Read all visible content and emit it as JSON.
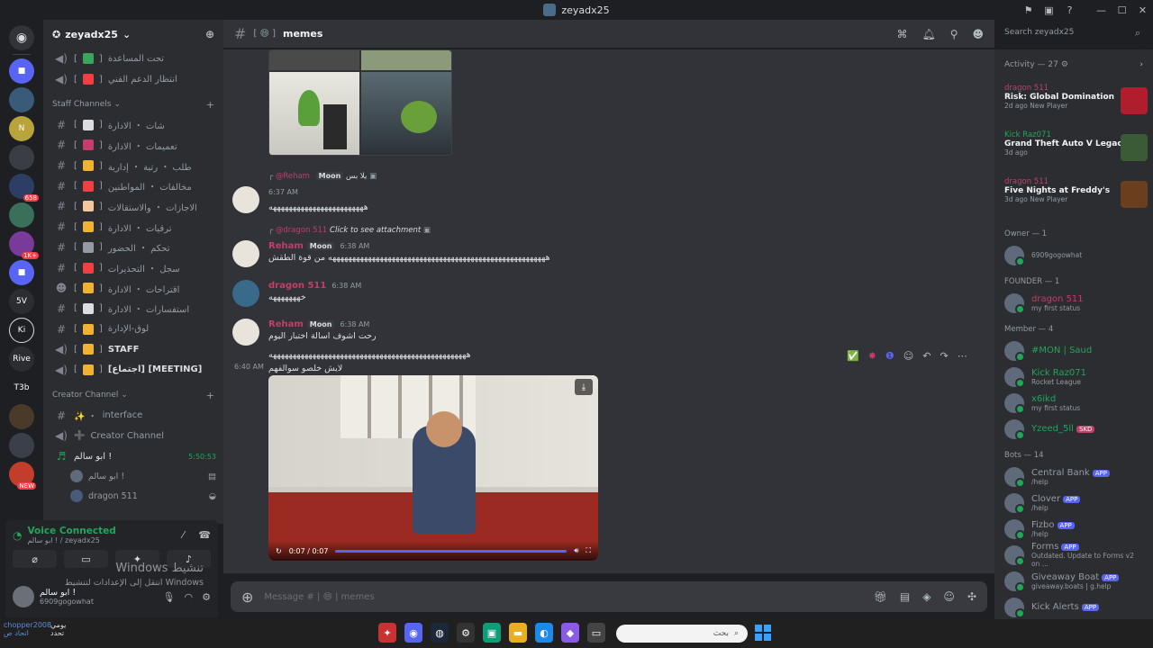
{
  "window": {
    "title": "zeyadx25"
  },
  "server": {
    "name": "zeyadx25"
  },
  "guild_badges": [
    "658",
    "1K+",
    "NEW"
  ],
  "guild_labels": [
    "5V",
    "Ki",
    "Rive",
    "T3b"
  ],
  "channels_top": [
    {
      "icon": "speaker",
      "label": "تحت المساعدة",
      "emoji_color": "#3ba55c"
    },
    {
      "icon": "speaker",
      "label": "انتظار الدعم الفني",
      "emoji_color": "#f23f43"
    }
  ],
  "staff_category": "Staff Channels",
  "staff_channels": [
    {
      "icon": "hash",
      "label": "شات ・ الادارة",
      "emoji_color": "#dbdee1"
    },
    {
      "icon": "hash",
      "label": "تعميمات ・ الادارة",
      "emoji_color": "#c33e68"
    },
    {
      "icon": "hash",
      "label": "طلب ・ رتبة ・ إدارية",
      "emoji_color": "#f0b232"
    },
    {
      "icon": "hash",
      "label": "مخالفات ・ المواطنين",
      "emoji_color": "#f23f43"
    },
    {
      "icon": "hash",
      "label": "الاجازات ・ والاستقالات",
      "emoji_color": "#f2c7a0"
    },
    {
      "icon": "hash",
      "label": "ترقيات ・ الادارة",
      "emoji_color": "#f0b232"
    },
    {
      "icon": "hash",
      "label": "تحكم ・ الحضور",
      "emoji_color": "#949ba4"
    },
    {
      "icon": "hash",
      "label": "سجل ・ التحذيرات",
      "emoji_color": "#f23f43"
    },
    {
      "icon": "people",
      "label": "اقتراحات ・ الادارة",
      "emoji_color": "#f0b232"
    },
    {
      "icon": "hash",
      "label": "استفسارات ・ الادارة",
      "emoji_color": "#dbdee1"
    },
    {
      "icon": "hash",
      "label": "لوق-الإدارة",
      "emoji_color": "#f0b232"
    },
    {
      "icon": "speaker",
      "label": "STAFF",
      "emoji_color": "#f0b232"
    },
    {
      "icon": "speaker",
      "label": "[اجتماع] [MEETING]",
      "emoji_color": "#f0b232"
    }
  ],
  "creator_category": "Creator Channel",
  "creator_channels": [
    {
      "icon": "hash",
      "label": "interface",
      "prefix": "✨ ・ "
    },
    {
      "icon": "speaker",
      "label": "Creator Channel",
      "prefix": "➕ "
    }
  ],
  "voice_channel": {
    "name": "ابو سالم !",
    "timer": "5:50:53"
  },
  "voice_users": [
    "ابو سالم !",
    "dragon 511"
  ],
  "voice_status": {
    "title": "Voice Connected",
    "sub": "ابو سالم ! / zeyadx25"
  },
  "user": {
    "name": "ابو سالم !",
    "status": "6909gogowhat"
  },
  "watermark": {
    "line1": "Windows تنشيط",
    "line2": "انتقل إلى الإعدادات لتنشيط Windows"
  },
  "chat": {
    "channel_name": "memes",
    "composer_placeholder": "Message # | 😄 | memes"
  },
  "search": {
    "placeholder": "Search zeyadx25"
  },
  "messages": [
    {
      "reply_name": "@Reham",
      "reply_tag": "Moon",
      "reply_text": "يلا بس",
      "author": "",
      "time": "6:37 AM",
      "text": "ههههههههههههههههههههههههه",
      "author_color": "#c33e68"
    },
    {
      "reply_name": "@dragon 511",
      "reply_text": "Click to see attachment",
      "author": "Reham",
      "tag": "Moon",
      "time": "6:38 AM",
      "text": "هههههههههههههههههههههههههههههههههههههههههههههههههههههههه من قوة الطقش",
      "author_color": "#c33e68"
    },
    {
      "author": "dragon 511",
      "time": "6:38 AM",
      "text": "خهههههههه",
      "author_color": "#c33e68"
    },
    {
      "author": "Reham",
      "tag": "Moon",
      "time": "6:38 AM",
      "text": "رحت اشوف اسالة اختبار اليوم",
      "text2": "ههههههههههههههههههههههههههههههههههههههههههههههههههه",
      "author_color": "#c33e68"
    }
  ],
  "video_msg": {
    "time": "6:40 AM",
    "text": "لايش خلصو سوالفهم",
    "video_time": "0:07 / 0:07",
    "progress": 1.0
  },
  "activity": {
    "header": "Activity — 27",
    "items": [
      {
        "user": "dragon 511",
        "game": "Risk: Global Domination",
        "meta": "2d ago",
        "extra": "New Player",
        "thumb_color": "#b01e2d"
      },
      {
        "user": "Kick Raz071",
        "game": "Grand Theft Auto V Legacy",
        "meta": "3d ago",
        "extra": "",
        "thumb_color": "#3b5a36",
        "user_color": "#23a55a"
      },
      {
        "user": "dragon 511",
        "game": "Five Nights at Freddy's",
        "meta": "3d ago",
        "extra": "New Player",
        "thumb_color": "#6b3f1e"
      }
    ]
  },
  "member_groups": [
    {
      "title": "Owner — 1",
      "members": [
        {
          "name": "",
          "sub": "6909gogowhat",
          "color": "#c33e68"
        }
      ]
    },
    {
      "title": "FOUNDER — 1",
      "members": [
        {
          "name": "dragon 511",
          "sub": "my first status",
          "color": "#c33e68"
        }
      ]
    },
    {
      "title": "Member — 4",
      "members": [
        {
          "name": "#MON | Saud",
          "sub": "",
          "color": "#23a55a"
        },
        {
          "name": "Kick Raz071",
          "sub": "Rocket League",
          "color": "#23a55a"
        },
        {
          "name": "x6ikd",
          "sub": "my first status",
          "color": "#23a55a"
        },
        {
          "name": "Yzeed_5ll",
          "sub": "",
          "color": "#23a55a",
          "tag": "SKD"
        }
      ]
    },
    {
      "title": "Bots — 14",
      "members": [
        {
          "name": "Central Bank",
          "sub": "/help",
          "color": "#949ba4",
          "app": "APP"
        },
        {
          "name": "Clover",
          "sub": "/help",
          "color": "#949ba4",
          "app": "APP"
        },
        {
          "name": "Fizbo",
          "sub": "/help",
          "color": "#949ba4",
          "app": "APP"
        },
        {
          "name": "Forms",
          "sub": "Outdated. Update to Forms v2 on ...",
          "color": "#949ba4",
          "app": "APP"
        },
        {
          "name": "Giveaway Boat",
          "sub": "giveaway.boats | g.help",
          "color": "#949ba4",
          "app": "APP"
        },
        {
          "name": "Kick Alerts",
          "sub": "",
          "color": "#949ba4",
          "app": "APP"
        }
      ]
    }
  ],
  "taskbar": {
    "search_placeholder": "بحث",
    "left1": "chopper2008",
    "left2": "يومي",
    "left3": "اتحاد ص",
    "left4": "تحدد"
  }
}
